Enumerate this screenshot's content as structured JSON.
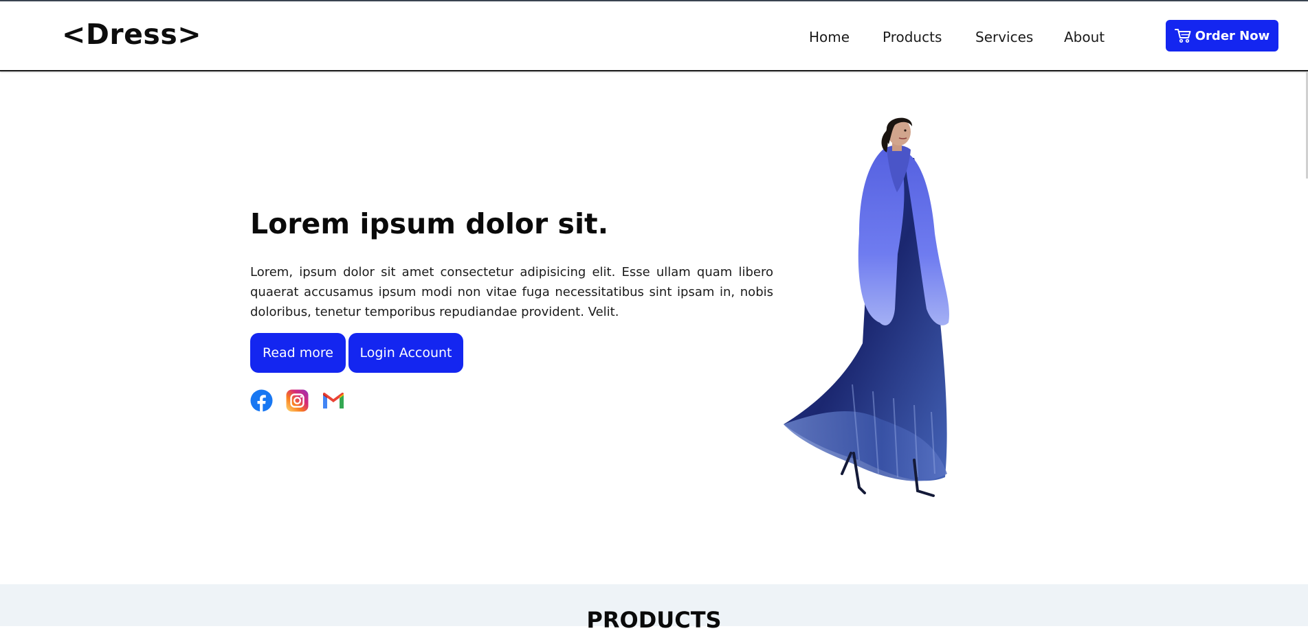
{
  "brand": {
    "logo_text": "<Dress>"
  },
  "nav": {
    "items": [
      {
        "label": "Home"
      },
      {
        "label": "Products"
      },
      {
        "label": "Services"
      },
      {
        "label": "About"
      }
    ],
    "cta_label": "Order Now",
    "cta_icon": "cart-icon"
  },
  "hero": {
    "title": "Lorem ipsum dolor sit.",
    "body": "Lorem, ipsum dolor sit amet consectetur adipisicing elit. Esse ullam quam libero quaerat accusamus ipsum modi non vitae fuga necessitatibus sint ipsam in, nobis doloribus, tenetur temporibus repudiandae provident. Velit.",
    "read_more_label": "Read more",
    "login_label": "Login Account",
    "social_icons": [
      "facebook-icon",
      "instagram-icon",
      "gmail-icon"
    ],
    "image": "fashion model in blue fur coat and dress"
  },
  "products": {
    "title": "PRODUCTS"
  },
  "colors": {
    "accent": "#1426f0",
    "band_bg": "#eef3f7",
    "text": "#111111"
  }
}
